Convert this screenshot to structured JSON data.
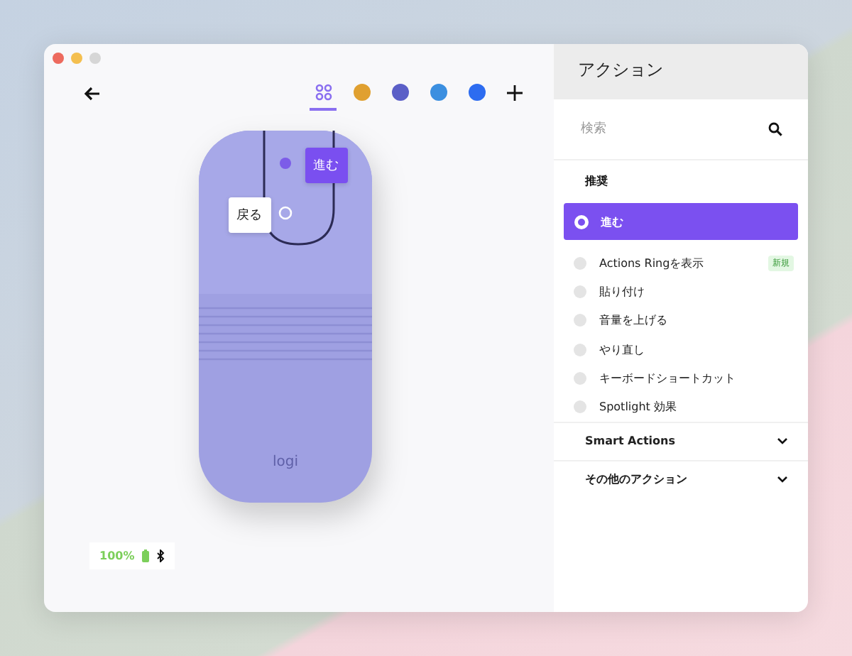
{
  "app_tabs": [
    {
      "kind": "all",
      "selected": true
    },
    {
      "kind": "chrome",
      "selected": false
    },
    {
      "kind": "teams",
      "selected": false
    },
    {
      "kind": "safari",
      "selected": false
    },
    {
      "kind": "zoom",
      "selected": false
    }
  ],
  "mouse": {
    "logo": "logi",
    "callouts": [
      {
        "label": "進む",
        "selected": true
      },
      {
        "label": "戻る",
        "selected": false
      }
    ]
  },
  "device_status": {
    "battery": "100%"
  },
  "actions_panel": {
    "title": "アクション",
    "search": {
      "placeholder": "検索"
    },
    "section_title": "推奨",
    "items": [
      {
        "label": "進む",
        "selected": true
      },
      {
        "label": "Actions Ringを表示",
        "selected": false,
        "badge": "新規"
      },
      {
        "label": "貼り付け",
        "selected": false
      },
      {
        "label": "音量を上げる",
        "selected": false
      },
      {
        "label": "やり直し",
        "selected": false
      },
      {
        "label": "キーボードショートカット",
        "selected": false
      },
      {
        "label": "Spotlight 効果",
        "selected": false
      }
    ],
    "groups": [
      {
        "label": "Smart Actions",
        "expanded": false
      },
      {
        "label": "その他のアクション",
        "expanded": false
      }
    ]
  }
}
